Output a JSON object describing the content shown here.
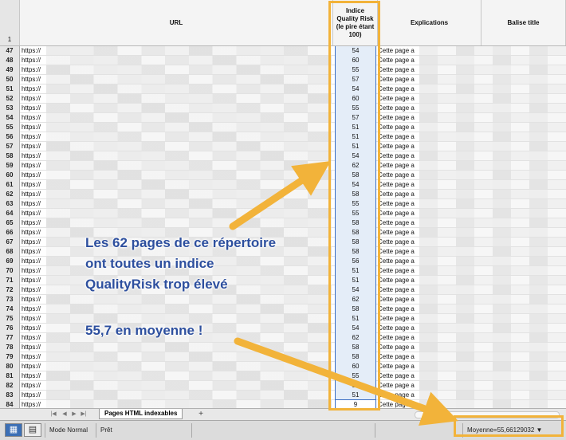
{
  "columns": {
    "row_header": "1",
    "url": "URL",
    "quality": "Indice Quality Risk (le pire étant 100)",
    "explications": "Explications",
    "balise_title": "Balise title"
  },
  "rows": [
    {
      "n": "47",
      "url": "https://",
      "score": "54",
      "expl": "Cette page a"
    },
    {
      "n": "48",
      "url": "https://",
      "score": "60",
      "expl": "Cette page a"
    },
    {
      "n": "49",
      "url": "https://",
      "score": "55",
      "expl": "Cette page a"
    },
    {
      "n": "50",
      "url": "https://",
      "score": "57",
      "expl": "Cette page a"
    },
    {
      "n": "51",
      "url": "https://",
      "score": "54",
      "expl": "Cette page a"
    },
    {
      "n": "52",
      "url": "https://",
      "score": "60",
      "expl": "Cette page a"
    },
    {
      "n": "53",
      "url": "https://",
      "score": "55",
      "expl": "Cette page a"
    },
    {
      "n": "54",
      "url": "https://",
      "score": "57",
      "expl": "Cette page a"
    },
    {
      "n": "55",
      "url": "https://",
      "score": "51",
      "expl": "Cette page a"
    },
    {
      "n": "56",
      "url": "https://",
      "score": "51",
      "expl": "Cette page a"
    },
    {
      "n": "57",
      "url": "https://",
      "score": "51",
      "expl": "Cette page a"
    },
    {
      "n": "58",
      "url": "https://",
      "score": "54",
      "expl": "Cette page a"
    },
    {
      "n": "59",
      "url": "https://",
      "score": "62",
      "expl": "Cette page a"
    },
    {
      "n": "60",
      "url": "https://",
      "score": "58",
      "expl": "Cette page a"
    },
    {
      "n": "61",
      "url": "https://",
      "score": "54",
      "expl": "Cette page a"
    },
    {
      "n": "62",
      "url": "https://",
      "score": "58",
      "expl": "Cette page a"
    },
    {
      "n": "63",
      "url": "https://",
      "score": "55",
      "expl": "Cette page a"
    },
    {
      "n": "64",
      "url": "https://",
      "score": "55",
      "expl": "Cette page a"
    },
    {
      "n": "65",
      "url": "https://",
      "score": "58",
      "expl": "Cette page a"
    },
    {
      "n": "66",
      "url": "https://",
      "score": "58",
      "expl": "Cette page a"
    },
    {
      "n": "67",
      "url": "https://",
      "score": "58",
      "expl": "Cette page a"
    },
    {
      "n": "68",
      "url": "https://",
      "score": "58",
      "expl": "Cette page a"
    },
    {
      "n": "69",
      "url": "https://",
      "score": "56",
      "expl": "Cette page a"
    },
    {
      "n": "70",
      "url": "https://",
      "score": "51",
      "expl": "Cette page a"
    },
    {
      "n": "71",
      "url": "https://",
      "score": "51",
      "expl": "Cette page a"
    },
    {
      "n": "72",
      "url": "https://",
      "score": "54",
      "expl": "Cette page a"
    },
    {
      "n": "73",
      "url": "https://",
      "score": "62",
      "expl": "Cette page a"
    },
    {
      "n": "74",
      "url": "https://",
      "score": "58",
      "expl": "Cette page a"
    },
    {
      "n": "75",
      "url": "https://",
      "score": "51",
      "expl": "Cette page a"
    },
    {
      "n": "76",
      "url": "https://",
      "score": "54",
      "expl": "Cette page a"
    },
    {
      "n": "77",
      "url": "https://",
      "score": "62",
      "expl": "Cette page a"
    },
    {
      "n": "78",
      "url": "https://",
      "score": "58",
      "expl": "Cette page a"
    },
    {
      "n": "79",
      "url": "https://",
      "score": "58",
      "expl": "Cette page a"
    },
    {
      "n": "80",
      "url": "https://",
      "score": "60",
      "expl": "Cette page a"
    },
    {
      "n": "81",
      "url": "https://",
      "score": "55",
      "expl": "Cette page a"
    },
    {
      "n": "82",
      "url": "https://",
      "score": "57",
      "expl": "Cette page a"
    },
    {
      "n": "83",
      "url": "https://",
      "score": "51",
      "expl": "Cette page a"
    },
    {
      "n": "84",
      "url": "https://",
      "score": "9",
      "expl": "Cette page a"
    }
  ],
  "tabs": {
    "sheet_name": "Pages HTML indexables",
    "add": "+"
  },
  "status": {
    "mode": "Mode Normal",
    "ready": "Prêt",
    "average": "Moyenne=55,66129032"
  },
  "annotation": {
    "line1": "Les 62 pages de ce répertoire",
    "line2": "ont toutes un indice",
    "line3": "QualityRisk trop élevé",
    "line4": "55,7 en moyenne !"
  },
  "colors": {
    "highlight": "#f2b33a",
    "annotation_text": "#2d4f9e",
    "selection": "#e4edf8"
  }
}
